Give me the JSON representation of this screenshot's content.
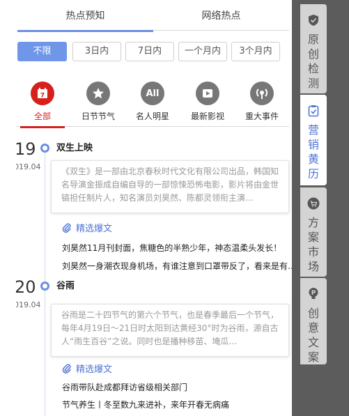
{
  "top_tabs": [
    {
      "label": "热点预知"
    },
    {
      "label": "网络热点"
    }
  ],
  "filters": [
    {
      "label": "不限"
    },
    {
      "label": "3日内"
    },
    {
      "label": "7日内"
    },
    {
      "label": "一个月内"
    },
    {
      "label": "3个月内"
    }
  ],
  "categories": [
    {
      "label": "全部",
      "icon": "calendar-icon",
      "color": "#d6201c"
    },
    {
      "label": "日节节气",
      "icon": "star-icon",
      "color": "#777777"
    },
    {
      "label": "名人明星",
      "icon": "all-icon",
      "badge": "All",
      "color": "#777777"
    },
    {
      "label": "最新影视",
      "icon": "play-icon",
      "color": "#777777"
    },
    {
      "label": "重大事件",
      "icon": "broadcast-icon",
      "color": "#777777"
    }
  ],
  "events": [
    {
      "day": "19",
      "date": "2019.04",
      "title": "双生上映",
      "description": "《双生》是一部由北京春秋时代文化有限公司出品，韩国知名导演金振成自编自导的一部惊悚恐怖电影，影片将由金世镐担任制片人，知名演员刘昊然、陈都灵领衔主演…",
      "best_label": "精选爆文",
      "items": [
        "刘昊然11月刊封面，焦糖色的半熟少年，神态温柔头发长！",
        "刘昊然一身潮衣现身机场，有谁注意到口罩带反了，看来是有…"
      ]
    },
    {
      "day": "20",
      "date": "2019.04",
      "title": "谷雨",
      "description": "谷雨是二十四节气的第六个节气，也是春季最后一个节气，每年4月19日～21日时太阳到达黄经30°时为谷雨，源自古人“雨生百谷”之说。同时也是播种移苗、埯瓜…",
      "best_label": "精选爆文",
      "items": [
        "谷雨带队赴成都拜访省级相关部门",
        "节气养生丨冬至数九来进补，来年开春无病痛"
      ]
    }
  ],
  "side_tabs": [
    {
      "label": "原创检测",
      "icon": "shield-icon"
    },
    {
      "label": "营销黄历",
      "icon": "clipboard-icon"
    },
    {
      "label": "方案市场",
      "icon": "cart-icon"
    },
    {
      "label": "创意文案",
      "icon": "bulb-icon"
    }
  ],
  "colors": {
    "accent": "#6b8fe3",
    "active_category": "#d6201c",
    "link": "#4f74d4",
    "side_panel": "#5c5c5c"
  }
}
